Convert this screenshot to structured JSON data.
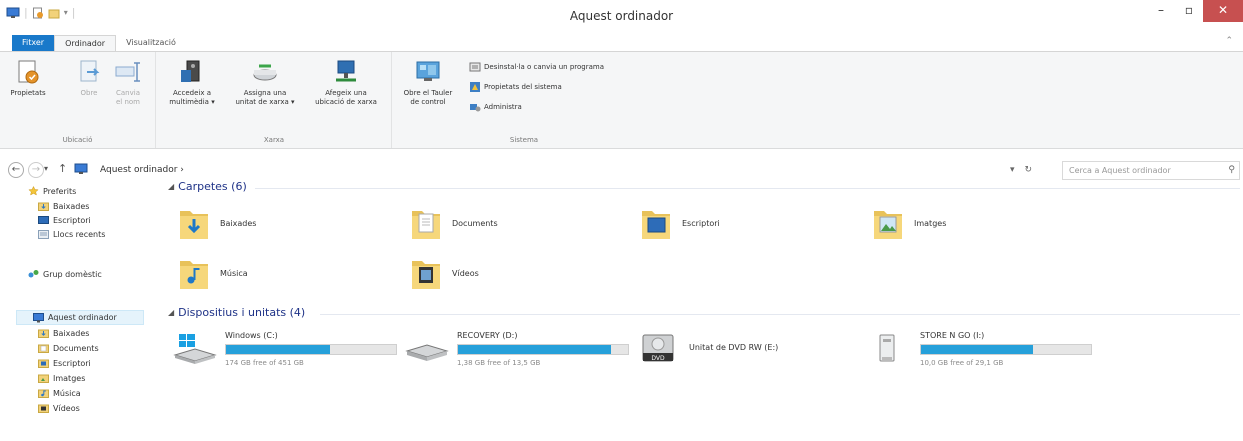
{
  "window": {
    "title": "Aquest ordinador",
    "minimize": "–",
    "maximize": "▫",
    "close": "✕"
  },
  "tabs": {
    "file": "Fitxer",
    "computer": "Ordinador",
    "view": "Visualització"
  },
  "ribbon": {
    "help": "⌃",
    "location_group": {
      "label": "Ubicació",
      "properties": "Propietats",
      "open": "Obre",
      "rename_l1": "Canvia",
      "rename_l2": "el nom"
    },
    "network_group": {
      "label": "Xarxa",
      "media_l1": "Accedeix a",
      "media_l2": "multimèdia ▾",
      "map_l1": "Assigna una",
      "map_l2": "unitat de xarxa ▾",
      "add_l1": "Afegeix una",
      "add_l2": "ubicació de xarxa"
    },
    "system_group": {
      "label": "Sistema",
      "control_l1": "Obre el Tauler",
      "control_l2": "de control",
      "uninstall": "Desinstal·la o canvia un programa",
      "sysprops": "Propietats del sistema",
      "manage": "Administra"
    }
  },
  "address": {
    "back": "←",
    "forward": "→",
    "dropdown": "▾",
    "up": "↑",
    "crumb": "Aquest ordinador ›",
    "path_dropdown": "▾",
    "refresh": "↻",
    "search_placeholder": "Cerca a Aquest ordinador",
    "search_icon": "⚲"
  },
  "nav": {
    "favorites": "Preferits",
    "fav_items": [
      "Baixades",
      "Escriptori",
      "Llocs recents"
    ],
    "homegroup": "Grup domèstic",
    "this_pc": "Aquest ordinador",
    "pc_items": [
      "Baixades",
      "Documents",
      "Escriptori",
      "Imatges",
      "Música",
      "Vídeos"
    ]
  },
  "folders": {
    "header": "Carpetes (6)",
    "items": [
      "Baixades",
      "Documents",
      "Escriptori",
      "Imatges",
      "Música",
      "Vídeos"
    ]
  },
  "devices": {
    "header": "Dispositius i unitats (4)",
    "items": [
      {
        "name": "Windows (C:)",
        "free": "174 GB free of 451 GB",
        "used_fraction": 0.614,
        "icon": "windows-drive-icon"
      },
      {
        "name": "RECOVERY (D:)",
        "free": "1,38 GB free of 13,5 GB",
        "used_fraction": 0.898,
        "icon": "hard-drive-icon"
      },
      {
        "name": "Unitat de DVD RW (E:)",
        "icon": "dvd-drive-icon"
      },
      {
        "name": "STORE N GO (I:)",
        "free": "10,0 GB free of 29,1 GB",
        "used_fraction": 0.656,
        "icon": "usb-drive-icon"
      }
    ]
  },
  "colors": {
    "accent": "#1979ca",
    "bar_fill": "#26a0da",
    "section_header": "#1e3287",
    "close_button": "#c75050"
  }
}
